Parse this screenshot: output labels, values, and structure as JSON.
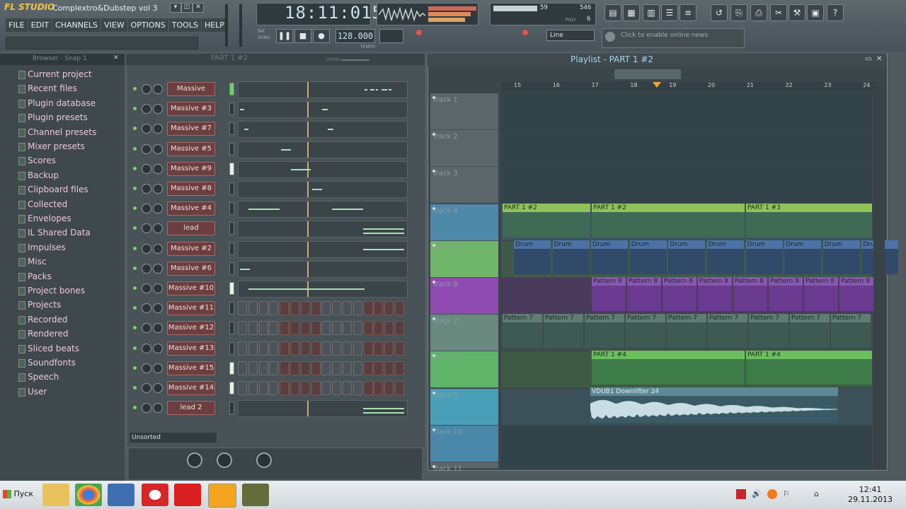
{
  "app": {
    "logo": "FL STUDIO",
    "title": "Complextro&Dubstep vol 3"
  },
  "menu": [
    "FILE",
    "EDIT",
    "CHANNELS",
    "VIEW",
    "OPTIONS",
    "TOOLS",
    "HELP"
  ],
  "transport": {
    "time": "18:11:015",
    "tempo": "128.000",
    "tempo_label": "TEMPO",
    "pat_label": "PAT",
    "song_label": "SONG"
  },
  "monitor": {
    "cpu_value": "59",
    "ram_value": "546",
    "poly_value": "6",
    "poly_label": "POLY"
  },
  "snap": {
    "value": "Line"
  },
  "news": {
    "text": "Click to enable online news"
  },
  "browser": {
    "header": "Browser - Snap 1",
    "items": [
      "Current project",
      "Recent files",
      "Plugin database",
      "Plugin presets",
      "Channel presets",
      "Mixer presets",
      "Scores",
      "Backup",
      "Clipboard files",
      "Collected",
      "Envelopes",
      "IL Shared Data",
      "Impulses",
      "Misc",
      "Packs",
      "Project bones",
      "Projects",
      "Recorded",
      "Rendered",
      "Sliced beats",
      "Soundfonts",
      "Speech",
      "User"
    ]
  },
  "channel_rack": {
    "pattern": "PART 1 #2",
    "swing_label": "SWING",
    "filter": "Unsorted",
    "channels": [
      "Massive",
      "Massive #3",
      "Massive #7",
      "Massive #5",
      "Massive #9",
      "Massive #8",
      "Massive #4",
      "lead",
      "Massive #2",
      "Massive #6",
      "Massive #10",
      "Massive #11",
      "Massive #12",
      "Massive #13",
      "Massive #15",
      "Massive #14",
      "lead 2"
    ]
  },
  "playlist": {
    "title": "Playlist - PART 1 #2",
    "timeline": [
      "15",
      "16",
      "17",
      "18",
      "19",
      "20",
      "21",
      "22",
      "23",
      "24"
    ],
    "tracks": [
      "Track 1",
      "Track 2",
      "Track 3",
      "Track 4",
      "Track 5",
      "Track 6",
      "Track 7",
      "Track 8",
      "Track 9",
      "Track 10",
      "Track 11"
    ],
    "clips": {
      "part_a": "PART 1 #2",
      "part_b": "PART 1 #3",
      "drum": "Drum",
      "pattern8": "Pattern 8",
      "pattern7": "Pattern 7",
      "part_c": "PART 1 #4",
      "downlifter": "VDUB1 Downlifter 24"
    }
  },
  "taskbar": {
    "start": "Пуск",
    "time": "12:41",
    "date": "29.11.2013"
  }
}
